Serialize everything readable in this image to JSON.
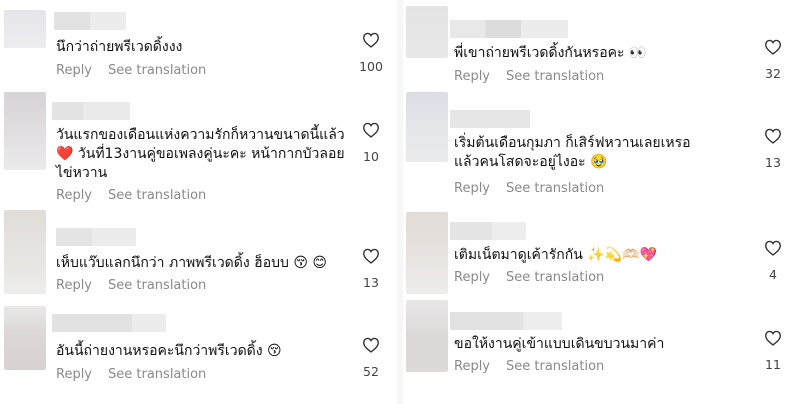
{
  "colors": {
    "reply": "#8a8a8a",
    "text": "#111111",
    "count": "#444444"
  },
  "icons": {
    "like": "heart-outline-icon"
  },
  "left": [
    {
      "text": "นึกว่าถ่ายพรีเวดดิ้งงง",
      "reply": "Reply",
      "see": "See translation",
      "likes": "100"
    },
    {
      "text": "วันแรกของเดือนแห่งความรักก็หวานขนาดนี้แล้ว\n❤️ วันที่13งานคู่ขอเพลงคู่นะคะ หน้ากากบัวลอย\nไข่หวาน",
      "reply": "Reply",
      "see": "See translation",
      "likes": "10"
    },
    {
      "text": "เห็บแว๊บแลกนึกว่า ภาพพรีเวดดิ้ง ฮ็อบบ 😚 😊",
      "reply": "Reply",
      "see": "See translation",
      "likes": "13"
    },
    {
      "text": "อันนี้ถ่ายงานหรอคะนึกว่าพรีเวดดิ้ง 😚",
      "reply": "Reply",
      "see": "See translation",
      "likes": "52"
    }
  ],
  "right": [
    {
      "text": "พี่เขาถ่ายพรีเวดดิ้งกันหรอคะ 👀",
      "reply": "Reply",
      "see": "See translation",
      "likes": "32"
    },
    {
      "text": "เริ่มต้นเดือนกุมภา ก็เสิร์ฟหวานเลยเหรอ\nแล้วคนโสดจะอยู่ไงอะ 🥹",
      "reply": "Reply",
      "see": "See translation",
      "likes": "13"
    },
    {
      "text": "เติมเน็ตมาดูเค้ารักกัน ✨💫🫶🏻💖",
      "reply": "Reply",
      "see": "See translation",
      "likes": "4"
    },
    {
      "text": "ขอให้งานคู่เข้าแบบเดินขบวนมาค่า",
      "reply": "Reply",
      "see": "See translation",
      "likes": "11"
    }
  ]
}
